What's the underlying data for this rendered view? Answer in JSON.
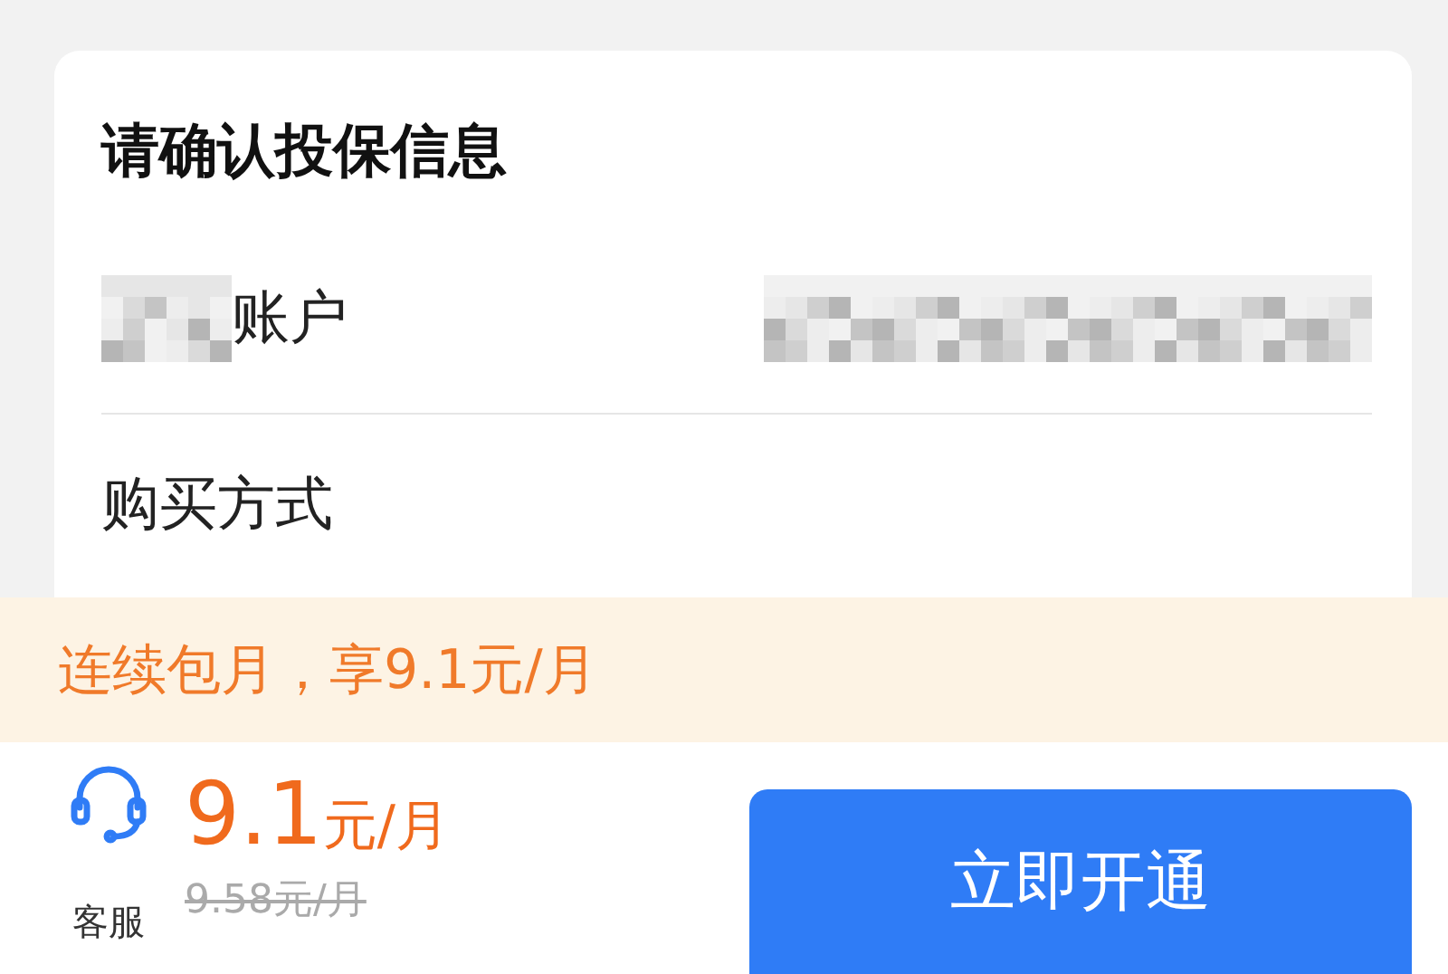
{
  "title": "请确认投保信息",
  "rows": [
    {
      "kind": "redacted",
      "label": "账户"
    },
    {
      "kind": "plain",
      "label": "购买方式"
    }
  ],
  "banner": {
    "text": "连续包月，享9.1元/月"
  },
  "footer": {
    "service_label": "客服",
    "price": "9.1",
    "price_unit": "元/月",
    "original_price": "9.58元/月",
    "button": "立即开通"
  }
}
